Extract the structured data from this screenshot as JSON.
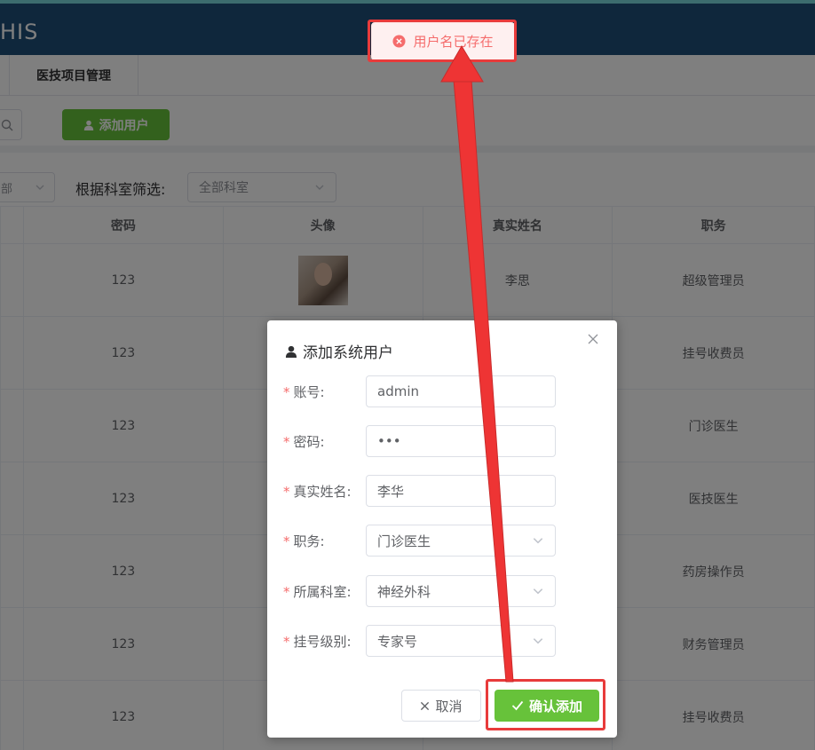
{
  "app": {
    "logo": "HIS"
  },
  "tabs": [
    {
      "label": "医技项目管理"
    }
  ],
  "toolbar": {
    "add_user_label": "添加用户"
  },
  "filters": {
    "left_select_value": "部",
    "dept_label": "根据科室筛选:",
    "dept_select_value": "全部科室"
  },
  "table": {
    "columns": [
      "密码",
      "头像",
      "真实姓名",
      "职务"
    ],
    "rows": [
      {
        "password": "123",
        "has_avatar": true,
        "real_name": "李思",
        "title": "超级管理员"
      },
      {
        "password": "123",
        "has_avatar": false,
        "real_name": "",
        "title": "挂号收费员"
      },
      {
        "password": "123",
        "has_avatar": false,
        "real_name": "",
        "title": "门诊医生"
      },
      {
        "password": "123",
        "has_avatar": false,
        "real_name": "",
        "title": "医技医生"
      },
      {
        "password": "123",
        "has_avatar": false,
        "real_name": "",
        "title": "药房操作员"
      },
      {
        "password": "123",
        "has_avatar": false,
        "real_name": "",
        "title": "财务管理员"
      },
      {
        "password": "123",
        "has_avatar": false,
        "real_name": "",
        "title": "挂号收费员"
      }
    ]
  },
  "dialog": {
    "title": "添加系统用户",
    "fields": [
      {
        "label": "账号:",
        "value": "admin",
        "type": "text"
      },
      {
        "label": "密码:",
        "value": "•••",
        "type": "password"
      },
      {
        "label": "真实姓名:",
        "value": "李华",
        "type": "text"
      },
      {
        "label": "职务:",
        "value": "门诊医生",
        "type": "select"
      },
      {
        "label": "所属科室:",
        "value": "神经外科",
        "type": "select"
      },
      {
        "label": "挂号级别:",
        "value": "专家号",
        "type": "select"
      }
    ],
    "required_mark": "*",
    "cancel_label": "取消",
    "confirm_label": "确认添加"
  },
  "toast": {
    "message": "用户名已存在",
    "type": "error"
  },
  "colors": {
    "header": "#1f4e79",
    "success": "#67c23a",
    "error": "#f56c6c",
    "annotation": "#e83b3b"
  }
}
